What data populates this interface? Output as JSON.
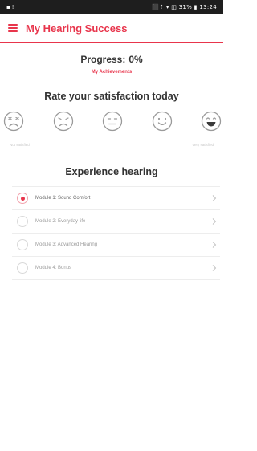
{
  "status_bar": {
    "left": "▪ ⁞",
    "right": "⬛⇡ ▾ ◫ 31% ▮ 13:24"
  },
  "app_bar": {
    "title": "My Hearing Success"
  },
  "progress": {
    "label": "Progress:",
    "value": "0%"
  },
  "achievements_link": "My Achievements",
  "satisfaction": {
    "title": "Rate your satisfaction today",
    "faces": [
      "very-unhappy-face-icon",
      "unhappy-face-icon",
      "neutral-face-icon",
      "happy-face-icon",
      "very-happy-face-icon"
    ],
    "min_label": "Not satisfied",
    "max_label": "Very satisfied"
  },
  "experience": {
    "title": "Experience hearing",
    "modules": [
      {
        "label": "Module 1: Sound Comfort",
        "active": true
      },
      {
        "label": "Module 2: Everyday life",
        "active": false
      },
      {
        "label": "Module 3: Advanced Hearing",
        "active": false
      },
      {
        "label": "Module 4: Bonus",
        "active": false
      }
    ]
  },
  "colors": {
    "accent": "#e8354c",
    "status_bar": "#1e1e1e"
  }
}
